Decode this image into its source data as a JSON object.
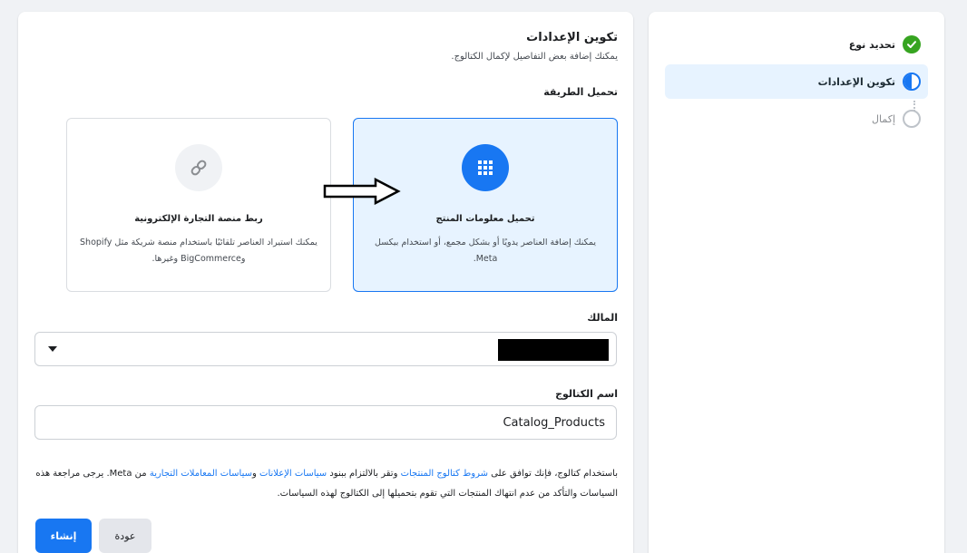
{
  "steps": [
    {
      "label": "تحديد نوع",
      "state": "done"
    },
    {
      "label": "تكوين الإعدادات",
      "state": "active"
    },
    {
      "label": "إكمال",
      "state": "pending"
    }
  ],
  "header": {
    "title": "تكوين الإعدادات",
    "subtitle": "يمكنك إضافة بعض التفاصيل لإكمال الكتالوج."
  },
  "method": {
    "label": "تحميل الطريقة",
    "options": [
      {
        "title": "تحميل معلومات المنتج",
        "description": "يمكنك إضافة العناصر يدويًا أو بشكل مجمع، أو استخدام بيكسل Meta.",
        "icon": "grid-icon",
        "selected": true
      },
      {
        "title": "ربط منصة التجارة الإلكترونية",
        "description": "يمكنك استيراد العناصر تلقائيًا باستخدام منصة شريكة مثل Shopify وBigCommerce وغيرها.",
        "icon": "link-icon",
        "selected": false
      }
    ]
  },
  "owner": {
    "label": "المالك"
  },
  "catalog": {
    "label": "اسم الكتالوج",
    "value": "Catalog_Products"
  },
  "terms": {
    "t1": "باستخدام كتالوج، فإنك توافق على ",
    "link1": "شروط كتالوج المنتجات",
    "t2": " وتقر بالالتزام ببنود ",
    "link2": "سياسات الإعلانات",
    "t3": " و",
    "link3": "سياسات المعاملات التجارية",
    "t4": " من Meta. يرجى مراجعة هذه السياسات والتأكد من عدم انتهاك المنتجات التي تقوم بتحميلها إلى الكتالوج لهذه السياسات."
  },
  "buttons": {
    "create": "إنشاء",
    "back": "عودة"
  },
  "colors": {
    "accent": "#1877f2",
    "success": "#36a420",
    "selected_bg": "#e7f3ff"
  }
}
